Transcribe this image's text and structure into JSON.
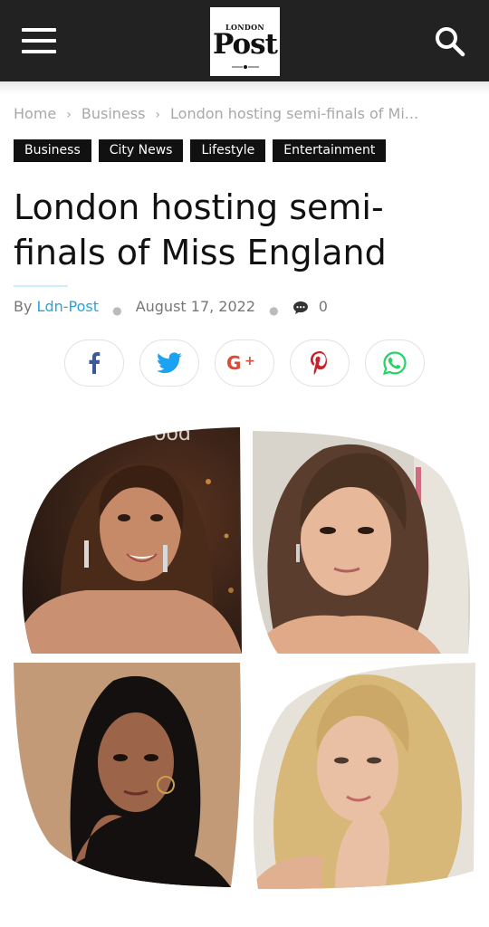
{
  "header": {
    "logo_top": "LONDON",
    "logo_main": "Post",
    "bg_color": "#222222"
  },
  "breadcrumbs": [
    "Home",
    "Business",
    "London hosting semi-finals of Mi..."
  ],
  "tags": [
    "Business",
    "City News",
    "Lifestyle",
    "Entertainment"
  ],
  "article": {
    "title": "London hosting semi-finals of Miss England",
    "by_label": "By",
    "author": "Ldn-Post",
    "date": "August 17, 2022",
    "comment_count": "0"
  },
  "share_buttons": [
    {
      "icon": "facebook-icon",
      "color": "#3b5998"
    },
    {
      "icon": "twitter-icon",
      "color": "#1da1f2"
    },
    {
      "icon": "google-plus-icon",
      "color": "#dc4a38"
    },
    {
      "icon": "pinterest-icon",
      "color": "#c8232c"
    },
    {
      "icon": "whatsapp-icon",
      "color": "#25d366"
    }
  ],
  "collage_overlay_text": "ood",
  "accent_color": "#2aa3d6"
}
